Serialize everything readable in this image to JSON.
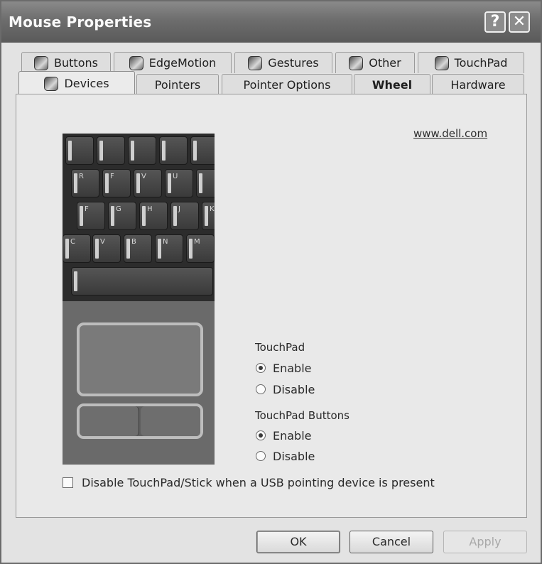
{
  "window": {
    "title": "Mouse Properties",
    "help_label": "?",
    "close_label": "✕"
  },
  "tabs": {
    "row1": [
      {
        "label": "Buttons"
      },
      {
        "label": "EdgeMotion"
      },
      {
        "label": "Gestures"
      },
      {
        "label": "Other"
      },
      {
        "label": "TouchPad"
      }
    ],
    "row2": [
      {
        "label": "Devices",
        "active": true
      },
      {
        "label": "Pointers"
      },
      {
        "label": "Pointer Options"
      },
      {
        "label": "Wheel"
      },
      {
        "label": "Hardware"
      }
    ]
  },
  "panel": {
    "link": "www.dell.com",
    "keyboard_keys": [
      "",
      "",
      "",
      "",
      "R",
      "F",
      "V",
      "U",
      "",
      "F",
      "G",
      "H",
      "J",
      "K",
      "C",
      "V",
      "B",
      "N",
      "M"
    ],
    "touchpad_group": {
      "label": "TouchPad",
      "options": [
        {
          "label": "Enable",
          "checked": true
        },
        {
          "label": "Disable",
          "checked": false
        }
      ]
    },
    "buttons_group": {
      "label": "TouchPad Buttons",
      "options": [
        {
          "label": "Enable",
          "checked": true
        },
        {
          "label": "Disable",
          "checked": false
        }
      ]
    },
    "usb_checkbox": {
      "label": "Disable TouchPad/Stick when a USB pointing device is present",
      "checked": false
    }
  },
  "footer": {
    "ok_label": "OK",
    "cancel_label": "Cancel",
    "apply_label": "Apply"
  }
}
